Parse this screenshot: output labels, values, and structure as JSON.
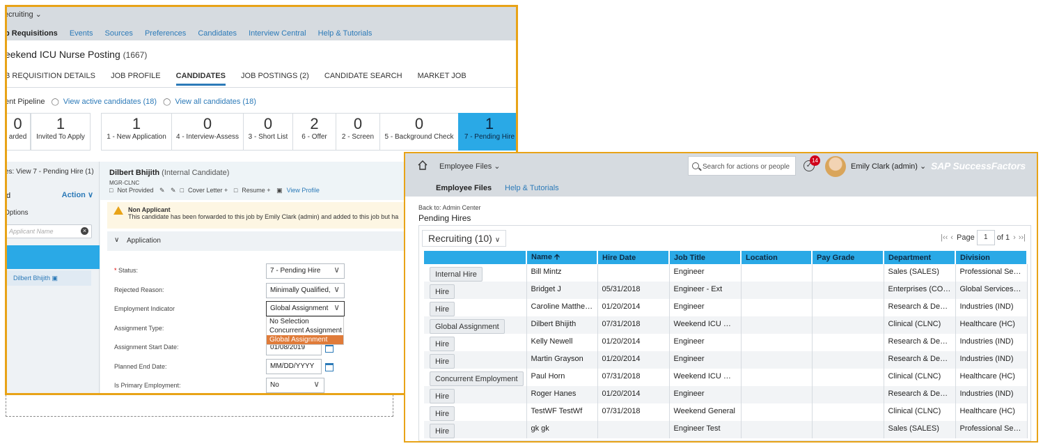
{
  "recruiting": {
    "module": "ecruiting",
    "nav": [
      "b Requisitions",
      "Events",
      "Sources",
      "Preferences",
      "Candidates",
      "Interview Central",
      "Help & Tutorials"
    ],
    "title": "eekend ICU Nurse Posting",
    "title_count": "(1667)",
    "tabs": [
      "B REQUISITION DETAILS",
      "JOB PROFILE",
      "CANDIDATES",
      "JOB POSTINGS (2)",
      "CANDIDATE SEARCH",
      "MARKET JOB"
    ],
    "pipeline": {
      "label": "ent Pipeline",
      "active_link": "View active candidates (18)",
      "all_link": "View all candidates (18)",
      "stages": [
        {
          "num": "0",
          "label": "arded"
        },
        {
          "num": "1",
          "label": "Invited To Apply"
        },
        {
          "num": "1",
          "label": "1 - New Application"
        },
        {
          "num": "0",
          "label": "4 - Interview-Assess"
        },
        {
          "num": "0",
          "label": "3 - Short List"
        },
        {
          "num": "2",
          "label": "6 - Offer"
        },
        {
          "num": "0",
          "label": "2 - Screen"
        },
        {
          "num": "0",
          "label": "5 - Background Check"
        },
        {
          "num": "1",
          "label": "7 - Pending Hire"
        }
      ]
    },
    "side": {
      "view_label": "es: View 7 - Pending Hire (1)",
      "d_label": "d",
      "action_label": "Action ∨",
      "options": "Options",
      "search_placeholder": "Applicant Name",
      "candidate": "Dilbert Bhijith"
    },
    "candidate": {
      "name": "Dilbert  Bhijith",
      "type": "(Internal Candidate)",
      "code": "MGR-CLNC",
      "links": [
        "Not  Provided",
        "Cover  Letter +",
        "Resume +",
        "View  Profile"
      ]
    },
    "warning": {
      "title": "Non Applicant",
      "message": "This candidate has been forwarded to this job by Emily Clark (admin) and added to this job but ha"
    },
    "application": {
      "section": "Application",
      "fields": [
        {
          "label": "Status:",
          "value": "7 - Pending Hire"
        },
        {
          "label": "Rejected Reason:",
          "value": "Minimally Qualified,"
        },
        {
          "label": "Employment Indicator",
          "value": "Global Assignment"
        },
        {
          "label": "Assignment Type:",
          "value": ""
        },
        {
          "label": "Assignment Start Date:",
          "value": "01/08/2019"
        },
        {
          "label": "Planned End Date:",
          "value": "MM/DD/YYYY"
        },
        {
          "label": "Is Primary Employment:",
          "value": "No"
        }
      ],
      "dropdown_options": [
        "No Selection",
        "Concurrent Assignment",
        "Global Assignment"
      ]
    }
  },
  "employee_files": {
    "module": "Employee Files",
    "search_placeholder": "Search for actions or people",
    "notification_count": "14",
    "user": "Emily Clark (admin)",
    "brand": "SAP SuccessFactors",
    "subnav": {
      "current": "Employee Files",
      "help": "Help & Tutorials"
    },
    "back_link": "Back to: Admin Center",
    "page_title": "Pending Hires",
    "filter": "Recruiting (10)",
    "pager": {
      "label": "Page",
      "value": "1",
      "of": "of 1"
    },
    "columns": [
      "",
      "Name",
      "Hire Date",
      "Job Title",
      "Location",
      "Pay Grade",
      "Department",
      "Division"
    ],
    "rows": [
      {
        "action": "Internal Hire",
        "name": "Bill Mintz",
        "hire_date": "",
        "job_title": "Engineer",
        "location": "",
        "pay_grade": "",
        "department": "Sales (SALES)",
        "division": "Professional Ser....."
      },
      {
        "action": "Hire",
        "name": "Bridget J",
        "hire_date": "05/31/2018",
        "job_title": "Engineer - Ext",
        "location": "",
        "pay_grade": "",
        "department": "Enterprises (CO......",
        "division": "Global Services ....."
      },
      {
        "action": "Hire",
        "name": "Caroline Matthe......",
        "hire_date": "01/20/2014",
        "job_title": "Engineer",
        "location": "",
        "pay_grade": "",
        "department": "Research & Dev......",
        "division": "Industries (IND)"
      },
      {
        "action": "Global Assignment",
        "name": "Dilbert Bhijith",
        "hire_date": "07/31/2018",
        "job_title": "Weekend ICU N......",
        "location": "",
        "pay_grade": "",
        "department": "Clinical (CLNC)",
        "division": "Healthcare (HC)"
      },
      {
        "action": "Hire",
        "name": "Kelly Newell",
        "hire_date": "01/20/2014",
        "job_title": "Engineer",
        "location": "",
        "pay_grade": "",
        "department": "Research & Dev......",
        "division": "Industries (IND)"
      },
      {
        "action": "Hire",
        "name": "Martin Grayson",
        "hire_date": "01/20/2014",
        "job_title": "Engineer",
        "location": "",
        "pay_grade": "",
        "department": "Research & Dev......",
        "division": "Industries (IND)"
      },
      {
        "action": "Concurrent Employment",
        "name": "Paul Horn",
        "hire_date": "07/31/2018",
        "job_title": "Weekend ICU N......",
        "location": "",
        "pay_grade": "",
        "department": "Clinical (CLNC)",
        "division": "Healthcare (HC)"
      },
      {
        "action": "Hire",
        "name": "Roger Hanes",
        "hire_date": "01/20/2014",
        "job_title": "Engineer",
        "location": "",
        "pay_grade": "",
        "department": "Research & Dev......",
        "division": "Industries (IND)"
      },
      {
        "action": "Hire",
        "name": "TestWF TestWf",
        "hire_date": "07/31/2018",
        "job_title": "Weekend General",
        "location": "",
        "pay_grade": "",
        "department": "Clinical (CLNC)",
        "division": "Healthcare (HC)"
      },
      {
        "action": "Hire",
        "name": "gk gk",
        "hire_date": "",
        "job_title": "Engineer Test",
        "location": "",
        "pay_grade": "",
        "department": "Sales (SALES)",
        "division": "Professional Ser....."
      }
    ],
    "colors": {
      "accent": "#2aa9e6",
      "frame": "#e8a317",
      "link": "#2c7ab8"
    }
  }
}
